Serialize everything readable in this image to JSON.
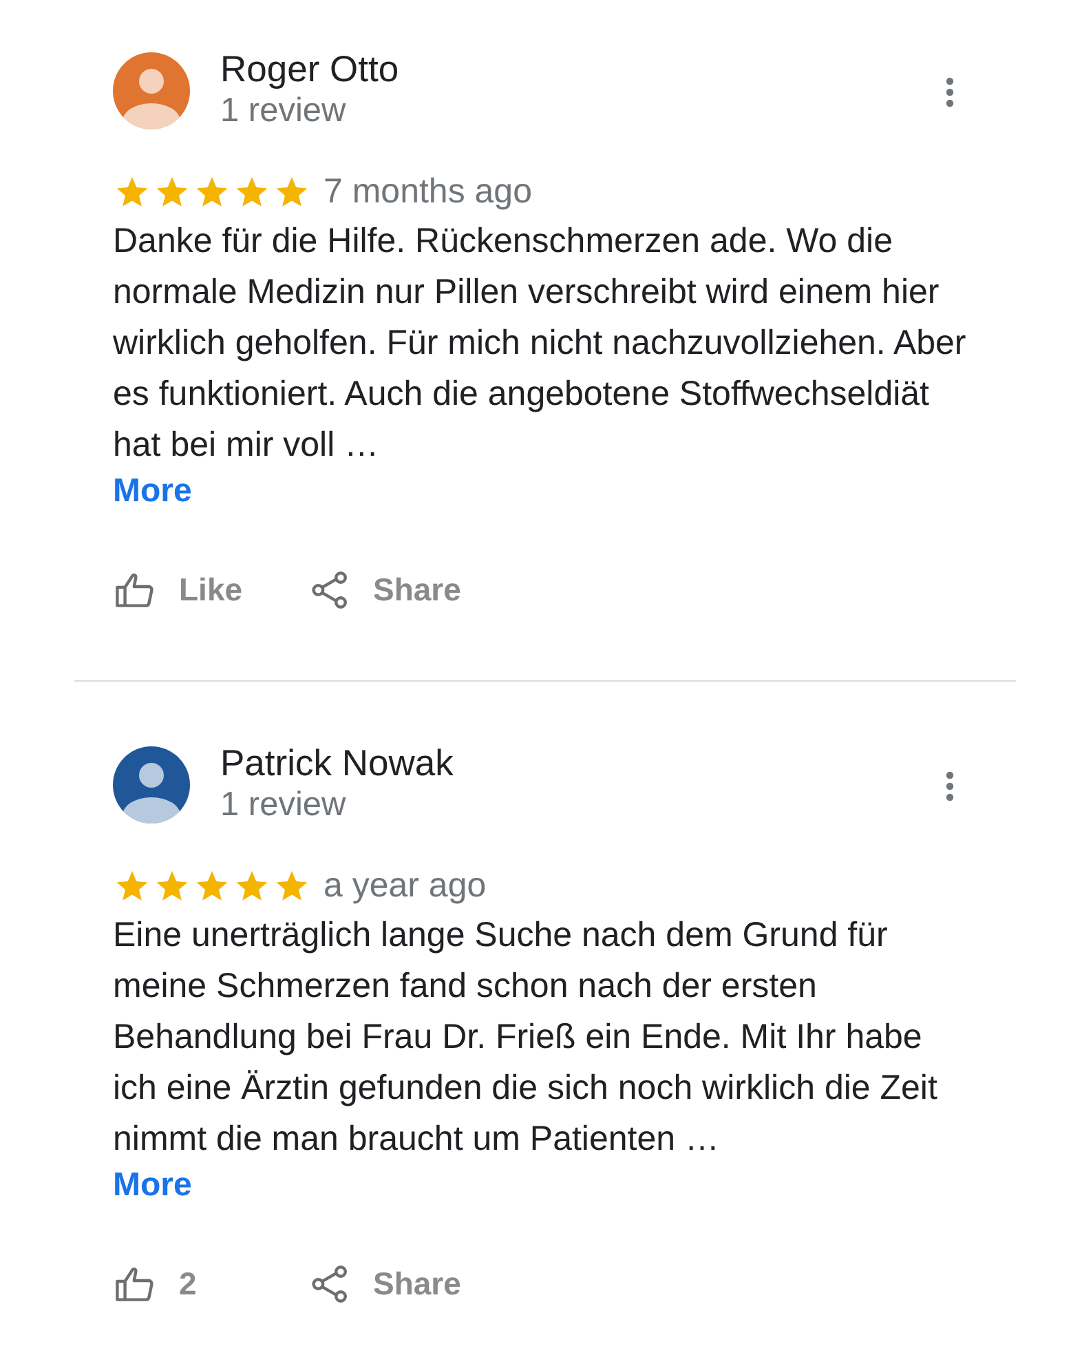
{
  "reviews": [
    {
      "reviewer": "Roger Otto",
      "review_count": "1 review",
      "avatar": {
        "color": "#e07431"
      },
      "stars": 5,
      "date": "7 months ago",
      "text": "Danke für die Hilfe. Rückenschmerzen ade. Wo die normale Medizin nur Pillen verschreibt wird einem hier wirklich geholfen. Für mich nicht nachzuvollziehen. Aber es funktioniert. Auch die angebotene Stoffwechseldiät hat bei mir voll …",
      "more": "More",
      "like": "Like",
      "share": "Share"
    },
    {
      "reviewer": "Patrick Nowak",
      "review_count": "1 review",
      "avatar": {
        "color": "#1f5799"
      },
      "stars": 5,
      "date": "a year ago",
      "text": "Eine unerträglich lange Suche nach dem Grund für meine Schmerzen fand schon nach der ersten Behandlung bei Frau Dr. Frieß ein Ende. Mit Ihr habe ich eine Ärztin gefunden die sich noch wirklich die Zeit nimmt die man braucht um Patienten …",
      "more": "More",
      "like": "2",
      "share": "Share"
    }
  ]
}
